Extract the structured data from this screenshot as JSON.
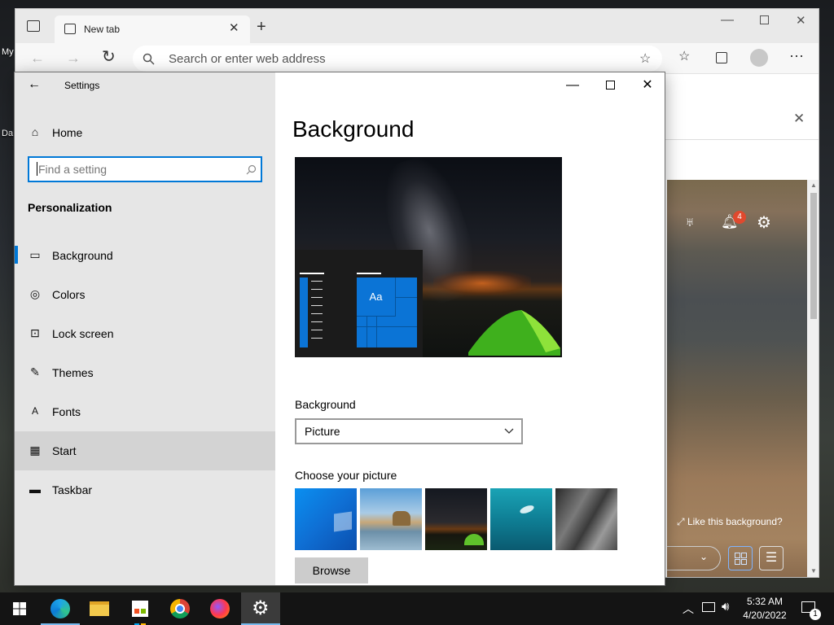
{
  "desktop": {
    "labels": [
      "My",
      "Da"
    ]
  },
  "edge": {
    "tab_title": "New tab",
    "address_placeholder": "Search or enter web address",
    "notification_count": "4",
    "like_background": "Like this background?"
  },
  "settings": {
    "title": "Settings",
    "home": "Home",
    "search_placeholder": "Find a setting",
    "section": "Personalization",
    "nav": [
      "Background",
      "Colors",
      "Lock screen",
      "Themes",
      "Fonts",
      "Start",
      "Taskbar"
    ],
    "selected_index": 0,
    "hovered_index": 5,
    "page_title": "Background",
    "preview_tile_text": "Aa",
    "background_label": "Background",
    "background_value": "Picture",
    "choose_label": "Choose your picture",
    "browse": "Browse"
  },
  "taskbar": {
    "time": "5:32 AM",
    "date": "4/20/2022",
    "notification_badge": "1"
  },
  "colors": {
    "accent": "#0078d7"
  }
}
